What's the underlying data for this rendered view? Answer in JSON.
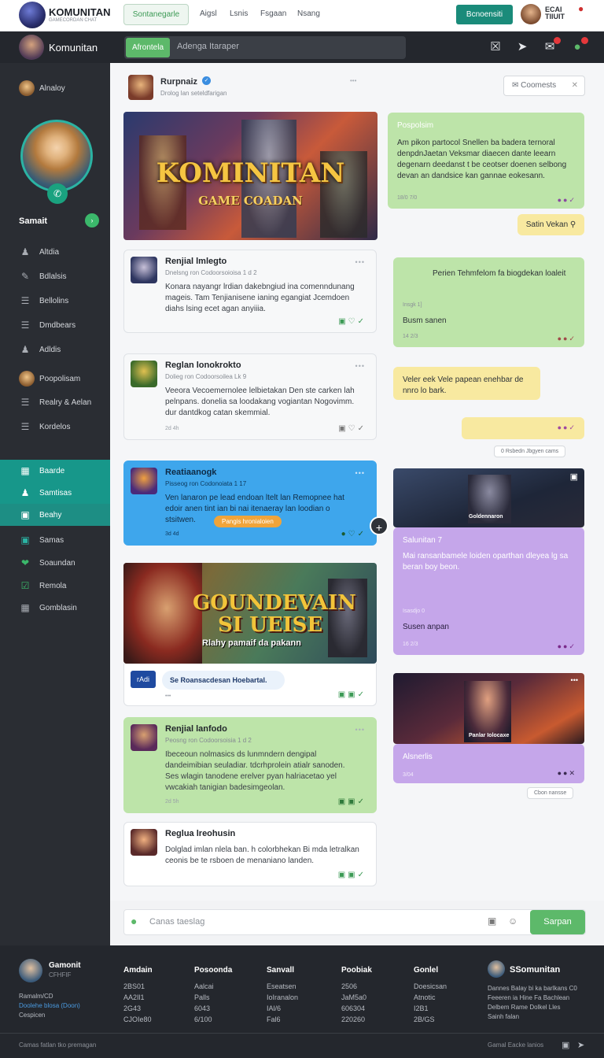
{
  "topbar": {
    "brand": "KOMUNITAN",
    "brand_sub": "GAMECORDAN CHAT",
    "search_label": "Sontanegarle",
    "nav": [
      "Aigsl",
      "Lsnis",
      "Fsgaan",
      "Nsang"
    ],
    "button": "Bcnoensiti",
    "user": "ECAI\nTIIUIT"
  },
  "secondbar": {
    "title": "Komunitan",
    "pill": "Afrontela",
    "search_placeholder": "Adenga Itaraper"
  },
  "sidebar": {
    "profile_label": "Alnaloy",
    "user_name": "Samait",
    "items": [
      {
        "label": "Altdia",
        "icon": "person-icon"
      },
      {
        "label": "Bdlalsis",
        "icon": "pen-icon"
      },
      {
        "label": "Bellolins",
        "icon": "list-icon"
      },
      {
        "label": "Dmdbears",
        "icon": "list-icon"
      },
      {
        "label": "Adldis",
        "icon": "person-icon"
      },
      {
        "label": "Poopolisam",
        "icon": "avatar"
      },
      {
        "label": "Realry & Aelan",
        "icon": "list-icon"
      },
      {
        "label": "Kordelos",
        "icon": "list-icon"
      },
      {
        "label": "Baarde",
        "icon": "grid-icon"
      },
      {
        "label": "Samtisas",
        "icon": "person-icon"
      },
      {
        "label": "Beahy",
        "icon": "doc-icon"
      },
      {
        "label": "Samas",
        "icon": "doc-icon"
      },
      {
        "label": "Soaundan",
        "icon": "heart-icon"
      },
      {
        "label": "Remola",
        "icon": "check-icon"
      },
      {
        "label": "Gomblasin",
        "icon": "calendar-icon"
      }
    ]
  },
  "postheader": {
    "name": "Rurpnaiz",
    "meta": "Drolog lan seteldfarigan",
    "comment_label": "Coomests"
  },
  "hero1": {
    "title": "KOMINITAN",
    "sub": "GAME COADAN"
  },
  "hero2": {
    "title": "GOUNDEVAIN",
    "title2": "SI UEISE",
    "sub": "Rlahy pamaif da pakann"
  },
  "cards": [
    {
      "title": "Renjial lmlegto",
      "meta": "Dnelsng ron Codoorsoioisa 1 d 2",
      "body": "Konara nayangr lrdian dakebngiud ina comenndunang mageis. Tam Tenjianisene ianing egangiat Jcemdoen diahs lsing ecet agan anyiiia.",
      "foot": ""
    },
    {
      "title": "Reglan lonokrokto",
      "meta": "Dolieg ron Codoorsoilea Lk 9",
      "body": "Veeora Vecoemernolee lelbietakan Den ste carken lah pelnpans. donelia sa loodakang vogiantan Nogovimm. dur dantdkog catan skemmial.",
      "foot": "2d 4h"
    },
    {
      "title": "Reatiaanogk",
      "meta": "Pisseog ron Codonoiata 1 17",
      "body": "Ven lanaron pe lead endoan ltelt lan Remopnee hat edoir anen tint ian bi nai itenaeray lan loodian o stsitwen.",
      "foot": "3d 4d",
      "tag": "Pangis hronialoien"
    },
    {
      "title": "Renjial lanfodo",
      "meta": "Peosng ron Codoorsoisia 1 d 2",
      "body": "Ibeceoun nolmasics ds lunmndern dengipal dandeimibian seuladiar. tdcrhprolein atialr sanoden. Ses wlagin tanodene erelver pyan halriacetao yel vwcakiah tanigian badesimgeolan.",
      "foot": "2d 5h"
    },
    {
      "title": "Reglua lreohusin",
      "meta": "",
      "body": "Dolglad imlan nlela ban. h colorbhekan Bi mda letralkan ceonis be te rsboen de menaniano landen.",
      "foot": ""
    }
  ],
  "linkbox": {
    "tag": "rAdi",
    "text": "Se Roansacdesan Hoebartal."
  },
  "bubbles": {
    "b1": {
      "title": "Pospolsim",
      "body": "Am pikon partocol Snellen ba badera ternoral denpdnJaetan Veksmar diaecen dante leearn degenarn deedanst t be ceotser doenen selbong devan an dandsice kan gannae eokesann.",
      "foot": "18/0 7/0"
    },
    "b2": {
      "label": "Satin Vekan"
    },
    "b3": {
      "title": "Perien Tehmfelom fa biogdekan loaleit",
      "sub": "Insgk 1]",
      "label": "Busm sanen",
      "foot": "14 2/3"
    },
    "b4": {
      "body": "Veler eek Vele papean enehbar de nnro lo bark."
    },
    "b5": {
      "chip": "0 Rsbedn Jbgyen cams"
    },
    "b6": {
      "title": "Salunitan 7",
      "body": "Mai ransanbamele loiden oparthan dleyea lg sa beran boy beon.",
      "sub": "Isasdjo 0",
      "label": "Susen anpan",
      "foot": "16 2/3"
    },
    "b7": {
      "title": "Alsnerlis",
      "foot": "3/04",
      "chip": "Cbon nansse"
    },
    "img1": {
      "caption": "Goldennaron"
    },
    "img2": {
      "caption": "Panlar Iolocaxe"
    }
  },
  "compose": {
    "placeholder": "Canas taeslag",
    "send": "Sarpan"
  },
  "footer": {
    "brand": "Gamonit",
    "brand_sub": "CFHFIF",
    "links": [
      "Ramalm/CD",
      "Doolehe blosa (Doon)",
      "Cespicen"
    ],
    "columns": [
      {
        "head": "Amdain",
        "items": [
          "2BS01",
          "AA2Il1",
          "2G43",
          "CJOIe80"
        ]
      },
      {
        "head": "Posoonda",
        "items": [
          "Aalcai",
          "Palls",
          "6043",
          "6/100"
        ]
      },
      {
        "head": "Sanvall",
        "items": [
          "Eseatsen",
          "IoIranalon",
          "IAl/6",
          "Fal6"
        ]
      },
      {
        "head": "Poobiak",
        "items": [
          "2506",
          "JaM5a0",
          "606304",
          "220260"
        ]
      },
      {
        "head": "Gonlel",
        "items": [
          "Doesicsan",
          "Atnotic",
          "I2B1",
          "2B/GS"
        ]
      }
    ],
    "right_title": "SSomunitan",
    "right_lines": [
      "Dannes Balay bi ka barlkans C0",
      "Feeeren ia Hine Fa Bachlean",
      "Delbem Rame Dolkel Lles",
      "Sainh falan"
    ],
    "bottom": "Camas fatlan tko premagan",
    "bottom_right": "Gamal Eacke lanios"
  },
  "colors": {
    "accent": "#17978a",
    "green": "#5db96a",
    "dark": "#24272d"
  }
}
